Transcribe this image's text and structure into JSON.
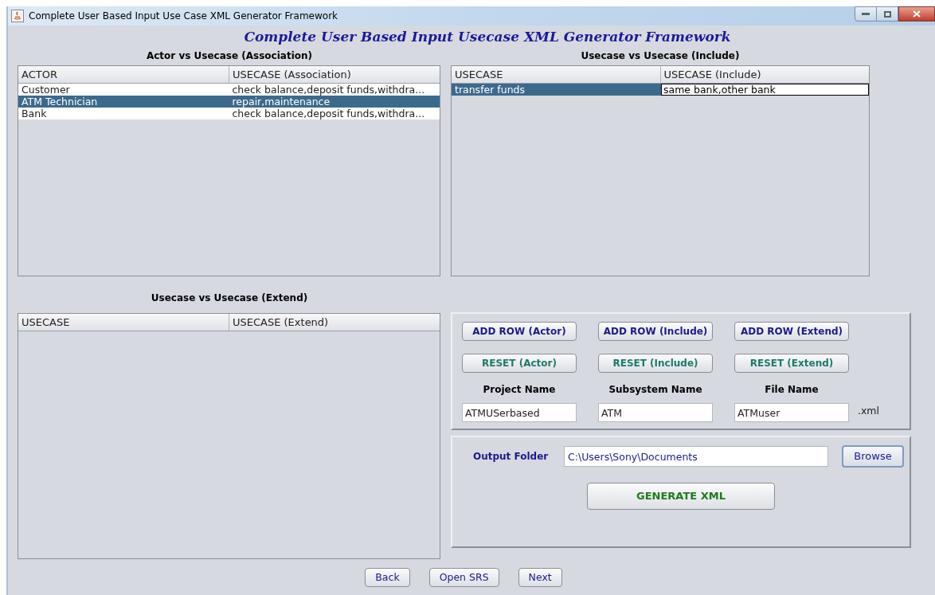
{
  "window": {
    "title": "Complete User Based Input Use Case XML Generator Framework"
  },
  "heading": "Complete User Based Input Usecase XML Generator Framework",
  "association": {
    "title": "Actor vs Usecase (Association)",
    "columns": [
      "ACTOR",
      "USECASE (Association)"
    ],
    "rows": [
      {
        "selected": false,
        "cells": [
          {
            "text": "Customer",
            "editing": false
          },
          {
            "text": "check balance,deposit funds,withdra...",
            "editing": false
          }
        ]
      },
      {
        "selected": true,
        "cells": [
          {
            "text": "ATM Technician",
            "editing": false
          },
          {
            "text": "repair,maintenance",
            "editing": false
          }
        ]
      },
      {
        "selected": false,
        "cells": [
          {
            "text": "Bank",
            "editing": false
          },
          {
            "text": "check balance,deposit funds,withdra...",
            "editing": false
          }
        ]
      }
    ]
  },
  "include": {
    "title": "Usecase vs Usecase (Include)",
    "columns": [
      "USECASE",
      "USECASE (Include)"
    ],
    "rows": [
      {
        "selected": true,
        "cells": [
          {
            "text": "transfer funds",
            "editing": false
          },
          {
            "text": "same bank,other bank",
            "editing": true
          }
        ]
      }
    ]
  },
  "extend": {
    "title": "Usecase vs Usecase (Extend)",
    "columns": [
      "USECASE",
      "USECASE (Extend)"
    ]
  },
  "add_buttons": [
    "ADD ROW (Actor)",
    "ADD ROW (Include)",
    "ADD ROW (Extend)"
  ],
  "reset_buttons": [
    "RESET (Actor)",
    "RESET (Include)",
    "RESET (Extend)"
  ],
  "fields": [
    {
      "label": "Project Name",
      "value": "ATMUSerbased"
    },
    {
      "label": "Subsystem Name",
      "value": "ATM"
    },
    {
      "label": "File Name",
      "value": "ATMuser"
    }
  ],
  "file_suffix": ".xml",
  "output": {
    "label": "Output Folder",
    "value": "C:\\Users\\Sony\\Documents",
    "browse": "Browse",
    "generate": "GENERATE XML"
  },
  "footer_buttons": [
    "Back",
    "Open SRS",
    "Next"
  ]
}
